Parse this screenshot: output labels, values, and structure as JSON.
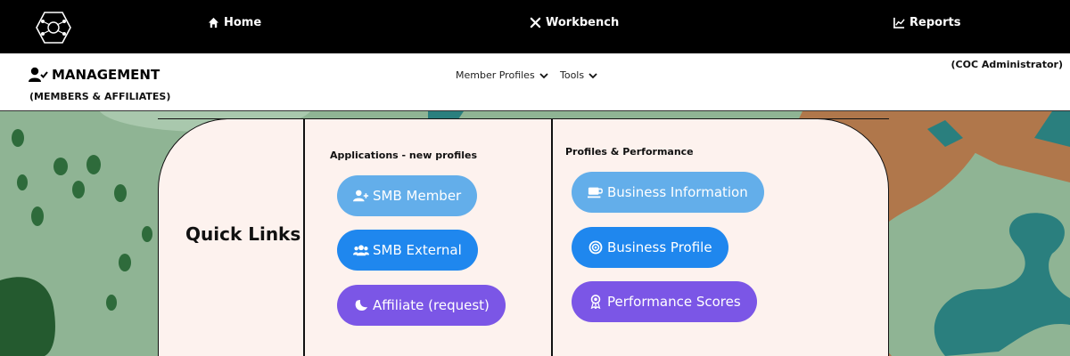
{
  "topnav": {
    "links": [
      {
        "label": "Home",
        "icon": "home-icon"
      },
      {
        "label": "Workbench",
        "icon": "tools-icon"
      },
      {
        "label": "Reports",
        "icon": "chart-line-icon"
      }
    ]
  },
  "header": {
    "title": "MANAGEMENT",
    "subtitle": "(MEMBERS & AFFILIATES)",
    "menus": [
      {
        "label": "Member Profiles"
      },
      {
        "label": "Tools"
      }
    ],
    "role": "(COC Administrator)"
  },
  "quick_links": {
    "title": "Quick Links",
    "applications": {
      "heading": "Applications - new profiles",
      "buttons": [
        {
          "label": "SMB Member",
          "icon": "user-plus-icon",
          "color": "#63aeea"
        },
        {
          "label": "SMB External",
          "icon": "users-icon",
          "color": "#1f87ee"
        },
        {
          "label": "Affiliate (request)",
          "icon": "moon-icon",
          "color": "#7b56e6"
        }
      ]
    },
    "profiles": {
      "heading": "Profiles & Performance",
      "buttons": [
        {
          "label": "Business Information",
          "icon": "coffee-icon",
          "color": "#63aeea"
        },
        {
          "label": "Business Profile",
          "icon": "bullseye-icon",
          "color": "#1f87ee"
        },
        {
          "label": "Performance Scores",
          "icon": "award-icon",
          "color": "#7b56e6"
        }
      ]
    }
  },
  "colors": {
    "nav_bg": "#000000",
    "panel_bg": "#fdf2ee",
    "background_green": "#8fb494"
  }
}
